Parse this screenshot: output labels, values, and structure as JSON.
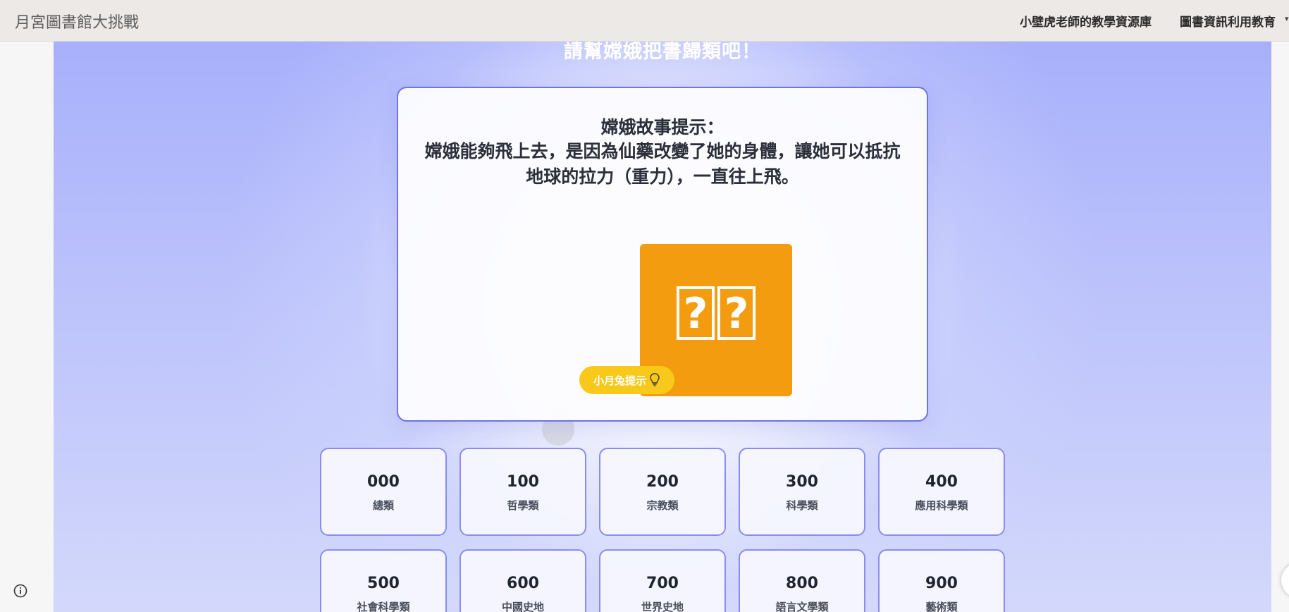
{
  "header": {
    "site_title": "月宮圖書館大挑戰",
    "nav": [
      {
        "label": "小壁虎老師的教學資源庫"
      },
      {
        "label": "圖書資訊利用教育"
      }
    ]
  },
  "stage": {
    "heading": "請幫嫦娥把書歸類吧！"
  },
  "question": {
    "hint_title": "嫦娥故事提示：",
    "hint_body": "嫦娥能夠飛上去，是因為仙藥改變了她的身體，讓她可以抵抗地球的拉力（重力），一直往上飛。",
    "image_glyphs": [
      "?",
      "?"
    ],
    "hint_button_label": "小月兔提示"
  },
  "categories": [
    {
      "code": "000",
      "name": "總類"
    },
    {
      "code": "100",
      "name": "哲學類"
    },
    {
      "code": "200",
      "name": "宗教類"
    },
    {
      "code": "300",
      "name": "科學類"
    },
    {
      "code": "400",
      "name": "應用科學類"
    },
    {
      "code": "500",
      "name": "社會科學類"
    },
    {
      "code": "600",
      "name": "中國史地"
    },
    {
      "code": "700",
      "name": "世界史地"
    },
    {
      "code": "800",
      "name": "語言文學類"
    },
    {
      "code": "900",
      "name": "藝術類"
    }
  ],
  "colors": {
    "accent": "#6e73e6",
    "image_bg": "#f39c10",
    "hint_button": "#f8c91b"
  },
  "icons": {
    "info": "info-icon",
    "bulb": "lightbulb-icon",
    "caret": "chevron-down-icon"
  }
}
